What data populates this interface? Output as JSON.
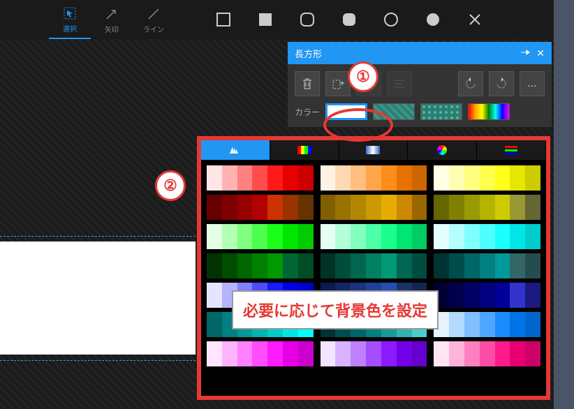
{
  "toolbar": {
    "select_label": "選択",
    "arrow_label": "矢印",
    "line_label": "ライン"
  },
  "panel": {
    "title": "長方形",
    "color_label": "カラー"
  },
  "annotations": {
    "circle1": "①",
    "circle2": "②",
    "text": "必要に応じて背景色を設定"
  },
  "color_rows": [
    [
      [
        "#ffe5e5",
        "#ffb3b3",
        "#ff8080",
        "#ff4d4d",
        "#ff1a1a",
        "#e60000",
        "#cc0000"
      ],
      [
        "#fff2e5",
        "#ffd9b3",
        "#ffbf80",
        "#ffa64d",
        "#ff8c1a",
        "#e67300",
        "#cc6600"
      ],
      [
        "#ffffe5",
        "#ffffb3",
        "#ffff80",
        "#ffff4d",
        "#ffff1a",
        "#e6e600",
        "#cccc00"
      ]
    ],
    [
      [
        "#660000",
        "#800000",
        "#990000",
        "#b30000",
        "#cc3300",
        "#993300",
        "#663300"
      ],
      [
        "#806000",
        "#997300",
        "#b38600",
        "#cc9900",
        "#e6ac00",
        "#cc8800",
        "#996600"
      ],
      [
        "#666600",
        "#808000",
        "#999900",
        "#b3b300",
        "#cccc00",
        "#999933",
        "#666633"
      ]
    ],
    [
      [
        "#e5ffe5",
        "#b3ffb3",
        "#80ff80",
        "#4dff4d",
        "#1aff1a",
        "#00e600",
        "#00cc00"
      ],
      [
        "#e5fff2",
        "#b3ffd9",
        "#80ffbf",
        "#4dffa6",
        "#1aff8c",
        "#00e673",
        "#00cc66"
      ],
      [
        "#e5ffff",
        "#b3ffff",
        "#80ffff",
        "#4dffff",
        "#1affff",
        "#00e6e6",
        "#00cccc"
      ]
    ],
    [
      [
        "#003300",
        "#004d00",
        "#006600",
        "#008000",
        "#009900",
        "#006633",
        "#004d26"
      ],
      [
        "#003326",
        "#004d39",
        "#00664d",
        "#008060",
        "#009973",
        "#006655",
        "#004d40"
      ],
      [
        "#003333",
        "#004d4d",
        "#006666",
        "#008080",
        "#009999",
        "#336666",
        "#264d4d"
      ]
    ],
    [
      [
        "#e5e5ff",
        "#b3b3ff",
        "#8080ff",
        "#4d4dff",
        "#1a1aff",
        "#0000e6",
        "#0000cc"
      ],
      [
        "#0d1a4d",
        "#132666",
        "#1a3380",
        "#204099",
        "#264db3",
        "#1a3366",
        "#132650"
      ],
      [
        "#000033",
        "#00004d",
        "#000066",
        "#000080",
        "#000099",
        "#3333cc",
        "#1a1a80"
      ]
    ],
    [
      [
        "#006666",
        "#008080",
        "#009999",
        "#00b3b3",
        "#00cccc",
        "#00e6e6",
        "#00ffff"
      ],
      [
        "#003333",
        "#004d4d",
        "#006666",
        "#008080",
        "#1a9999",
        "#33b3b3",
        "#4dcccc"
      ],
      [
        "#e5f2ff",
        "#b3d9ff",
        "#80bfff",
        "#4da6ff",
        "#1a8cff",
        "#0073e6",
        "#0066cc"
      ]
    ],
    [
      [
        "#ffe5ff",
        "#ffb3ff",
        "#ff80ff",
        "#ff4dff",
        "#ff1aff",
        "#e600e6",
        "#cc00cc"
      ],
      [
        "#f2e5ff",
        "#d9b3ff",
        "#bf80ff",
        "#a64dff",
        "#8c1aff",
        "#7300e6",
        "#6600cc"
      ],
      [
        "#ffe5f2",
        "#ffb3d9",
        "#ff80bf",
        "#ff4da6",
        "#ff1a8c",
        "#e60073",
        "#cc0066"
      ]
    ]
  ]
}
